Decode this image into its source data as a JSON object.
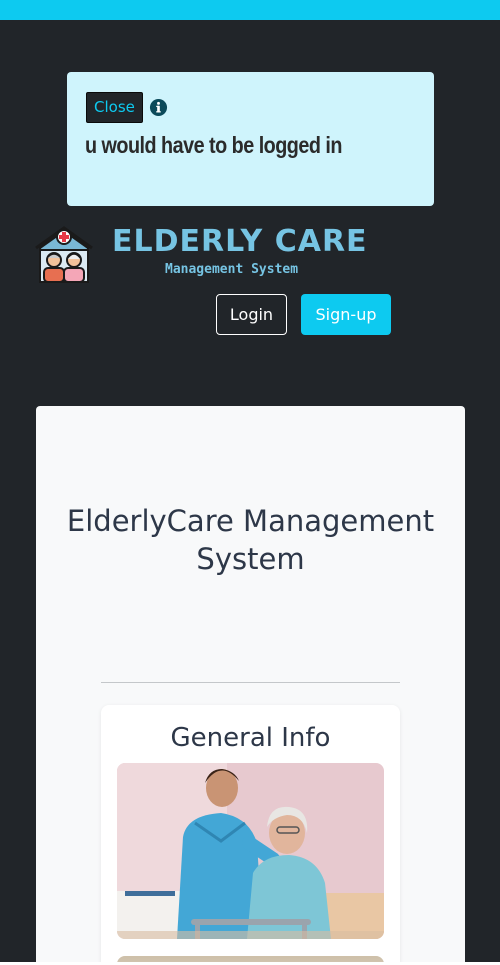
{
  "notice": {
    "close_label": "Close",
    "marquee_text": "To access this feature, you would have to be logged in"
  },
  "logo": {
    "title": "ELDERLY CARE",
    "subtitle": "Management System"
  },
  "nav": {
    "login_label": "Login",
    "signup_label": "Sign-up"
  },
  "main": {
    "title": "ElderlyCare Management System"
  },
  "info_card": {
    "title": "General Info"
  },
  "colors": {
    "accent": "#0dcaf0",
    "background": "#212529",
    "notice_bg": "#cff4fc",
    "logo_color": "#76c4e3"
  },
  "icons": {
    "info": "info-circle-icon",
    "house": "house-elderly-icon"
  }
}
